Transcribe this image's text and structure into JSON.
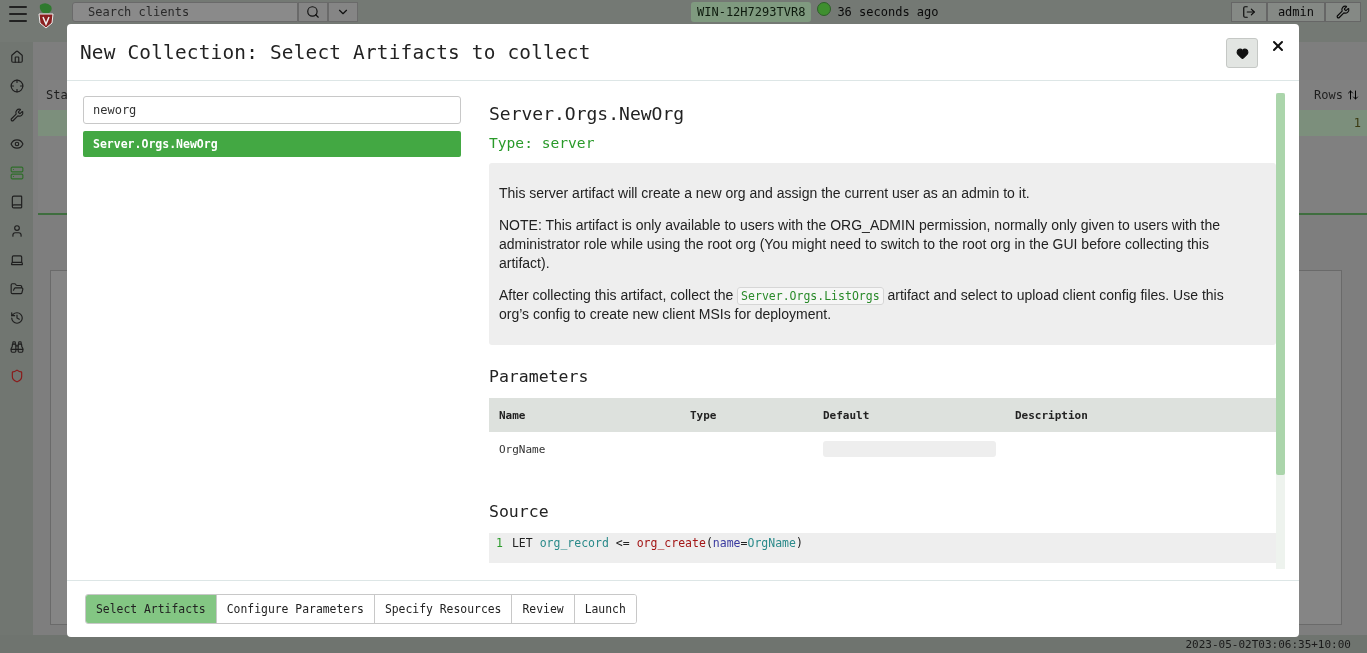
{
  "app": {
    "search": {
      "placeholder": "Search clients"
    },
    "client_id": "WIN-12H7293TVR8",
    "client_online": true,
    "last_seen": "36 seconds ago",
    "user": "admin",
    "sidebar_items": [
      {
        "selected": false
      },
      {
        "selected": false
      },
      {
        "selected": false
      },
      {
        "selected": false
      },
      {
        "selected": true
      },
      {
        "selected": false
      },
      {
        "selected": false
      },
      {
        "selected": false
      },
      {
        "selected": false
      },
      {
        "selected": false
      },
      {
        "selected": false
      },
      {
        "selected": false
      }
    ],
    "table": {
      "column_1": "Sta",
      "column_2": "Rows",
      "row_value": "1"
    },
    "status_time": "2023-05-02T03:06:35+10:00"
  },
  "modal": {
    "title": "New Collection: Select Artifacts to collect",
    "search": {
      "value": "neworg"
    },
    "results": [
      {
        "label": "Server.Orgs.NewOrg",
        "selected": true
      }
    ],
    "artifact": {
      "name": "Server.Orgs.NewOrg",
      "type": "Type: server",
      "description": [
        [
          {
            "text": "This server artifact will create a new org and assign the current user as an admin to it."
          }
        ],
        [
          {
            "text": "NOTE: This artifact is only available to users with the ORG_ADMIN permission, normally only given to users with the administrator role while using the root org (You might need to switch to the root org in the GUI before collecting this artifact)."
          }
        ],
        [
          {
            "text": "After collecting this artifact, collect the "
          },
          {
            "code": "Server.Orgs.ListOrgs"
          },
          {
            "text": " artifact and select to upload client config files. Use this org’s config to create new client MSIs for deployment."
          }
        ]
      ],
      "parameters_heading": "Parameters",
      "parameter_columns": [
        "Name",
        "Type",
        "Default",
        "Description"
      ],
      "parameters": [
        {
          "name": "OrgName"
        }
      ],
      "source_heading": "Source",
      "source_lines": [
        {
          "number": "1",
          "tokens": [
            {
              "kind": "keyword",
              "text": "LET"
            },
            {
              "kind": "variable",
              "text": "org_record"
            },
            {
              "kind": "operator",
              "text": "<="
            },
            {
              "kind": "function",
              "text": "org_create"
            },
            {
              "kind": "punct",
              "text": "("
            },
            {
              "kind": "param",
              "text": "name"
            },
            {
              "kind": "punct",
              "text": "="
            },
            {
              "kind": "variable",
              "text": "OrgName"
            },
            {
              "kind": "punct",
              "text": ")"
            }
          ]
        }
      ]
    },
    "steps": [
      {
        "label": "Select Artifacts",
        "selected": true
      },
      {
        "label": "Configure Parameters",
        "selected": false
      },
      {
        "label": "Specify Resources",
        "selected": false
      },
      {
        "label": "Review",
        "selected": false
      },
      {
        "label": "Launch",
        "selected": false
      }
    ]
  }
}
